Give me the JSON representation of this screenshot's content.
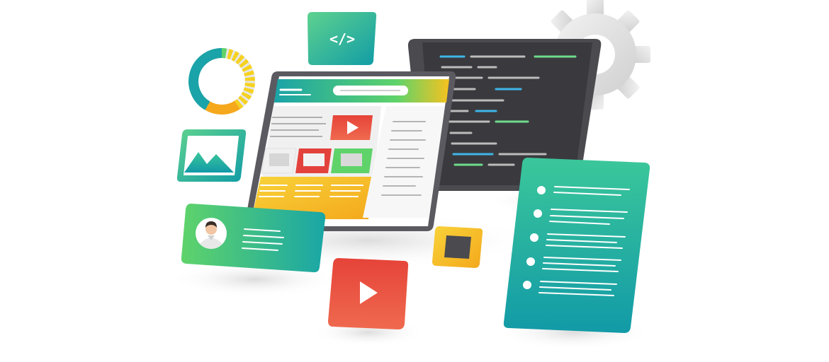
{
  "illustration": {
    "code_icon_text": "</>",
    "icons": {
      "code": "code-icon",
      "donut": "donut-chart-icon",
      "image": "image-icon",
      "gear": "gear-icon",
      "play": "play-icon",
      "avatar": "avatar-icon",
      "square": "square-icon"
    },
    "palette": {
      "teal": "#1aa3a8",
      "green": "#5fd36a",
      "yellow": "#f6c21f",
      "red": "#e3423c",
      "dark_gray": "#3e3e42",
      "light_gray": "#e9e9e9"
    }
  }
}
